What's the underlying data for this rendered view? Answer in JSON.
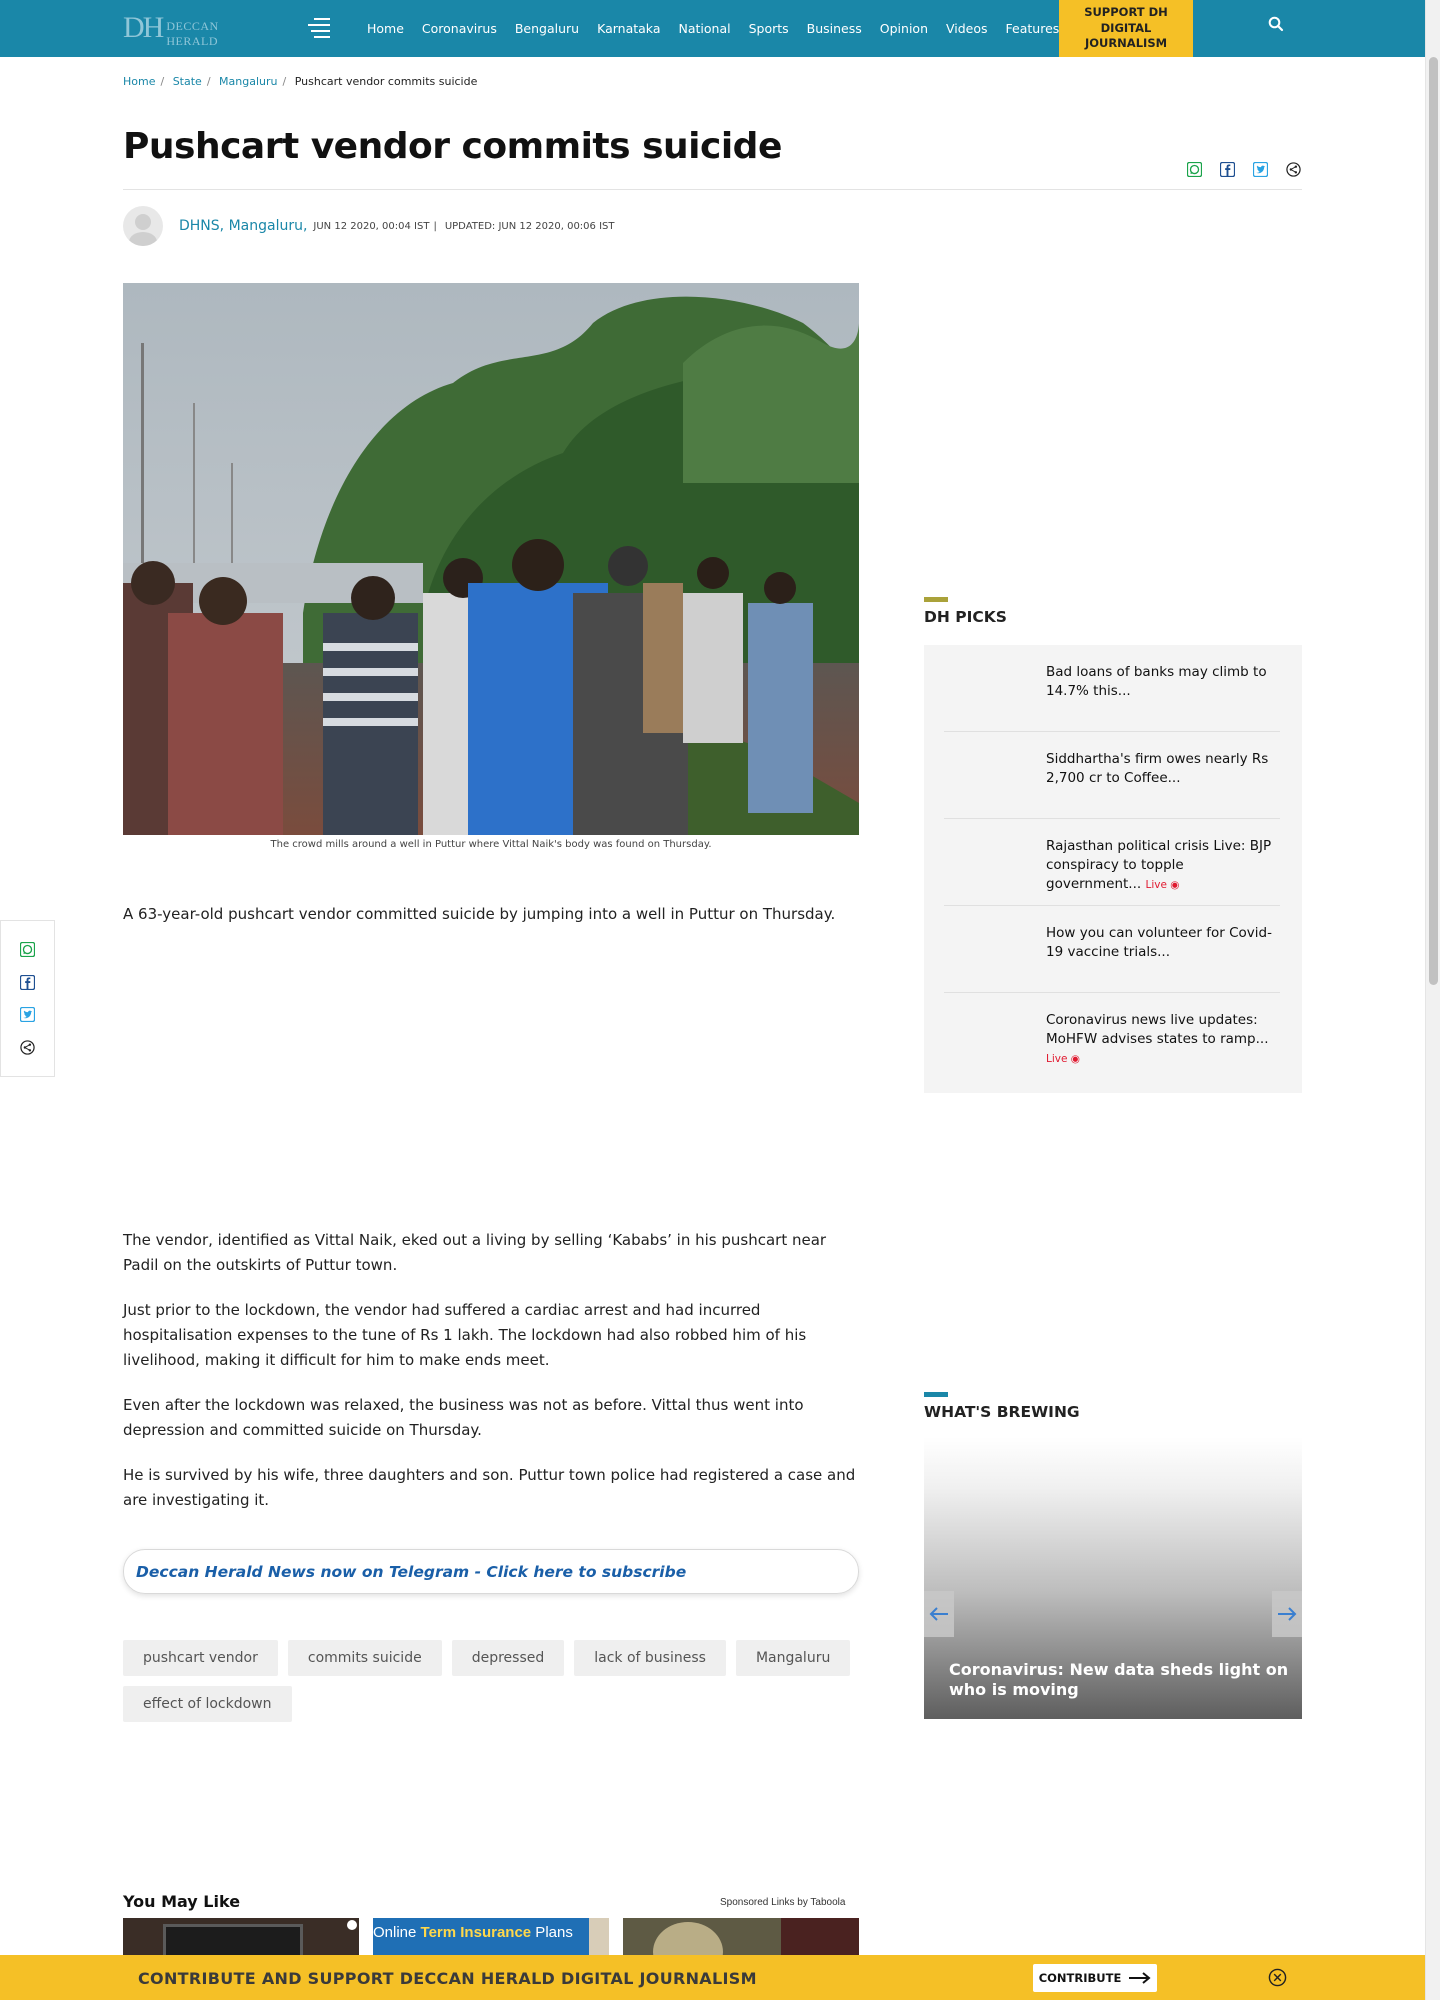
{
  "header": {
    "logo_mark": "DH",
    "logo_name": "DECCAN HERALD",
    "nav": [
      "Home",
      "Coronavirus",
      "Bengaluru",
      "Karnataka",
      "National",
      "Sports",
      "Business",
      "Opinion",
      "Videos",
      "Features"
    ],
    "support_line1": "SUPPORT DH",
    "support_line2": "DIGITAL JOURNALISM",
    "brand_color": "#1a87a8",
    "accent_color": "#f5c026"
  },
  "breadcrumb": {
    "items": [
      "Home",
      "State",
      "Mangaluru"
    ],
    "current": "Pushcart vendor commits suicide"
  },
  "article": {
    "title": "Pushcart vendor commits suicide",
    "author": "DHNS, Mangaluru,",
    "published": "JUN 12 2020, 00:04 IST",
    "separator": "|",
    "updated": "UPDATED: JUN 12 2020, 00:06 IST",
    "image_caption": "The crowd mills around a well in Puttur where Vittal Naik's body was found on Thursday.",
    "paragraphs": [
      "A 63-year-old pushcart vendor committed suicide by jumping into a well in Puttur on Thursday.",
      "The vendor, identified as Vittal Naik, eked out a living by selling ‘Kababs’ in his pushcart near Padil on the outskirts of Puttur town.",
      "Just prior to the lockdown, the vendor had suffered a cardiac arrest and had incurred hospitalisation expenses to the tune of Rs 1 lakh. The lockdown had also robbed him of his livelihood, making it difficult for him to make ends meet.",
      "Even after the lockdown was relaxed, the business was not as before. Vittal thus went into depression and committed suicide on Thursday.",
      "He is survived by his wife, three daughters and son. Puttur town police had registered a case and are investigating it."
    ],
    "telegram_link": "Deccan Herald News now on Telegram - Click here to subscribe",
    "tags": [
      "pushcart vendor",
      "commits suicide",
      "depressed",
      "lack of business",
      "Mangaluru",
      "effect of lockdown"
    ]
  },
  "you_may_like": {
    "title": "You May Like",
    "sponsored": "Sponsored Links by Taboola",
    "card2_text_a": "Online ",
    "card2_text_b": "Term Insurance",
    "card2_text_c": " Plans"
  },
  "sidebar": {
    "dh_picks_title": "DH PICKS",
    "picks": [
      {
        "text": "Bad loans of banks may climb to 14.7% this...",
        "live": ""
      },
      {
        "text": "Siddhartha's firm owes nearly Rs 2,700 cr to Coffee...",
        "live": ""
      },
      {
        "text": "Rajasthan political crisis Live: BJP conspiracy to topple government...",
        "live": "Live"
      },
      {
        "text": "How you can volunteer for Covid-19 vaccine trials...",
        "live": ""
      },
      {
        "text": "Coronavirus news live updates: MoHFW advises states to ramp...",
        "live": "Live"
      }
    ],
    "brewing_title": "WHAT'S BREWING",
    "brewing_headline": "Coronavirus: New data sheds light on who is moving"
  },
  "contribute": {
    "message": "CONTRIBUTE AND SUPPORT DECCAN HERALD DIGITAL JOURNALISM",
    "button": "CONTRIBUTE"
  }
}
